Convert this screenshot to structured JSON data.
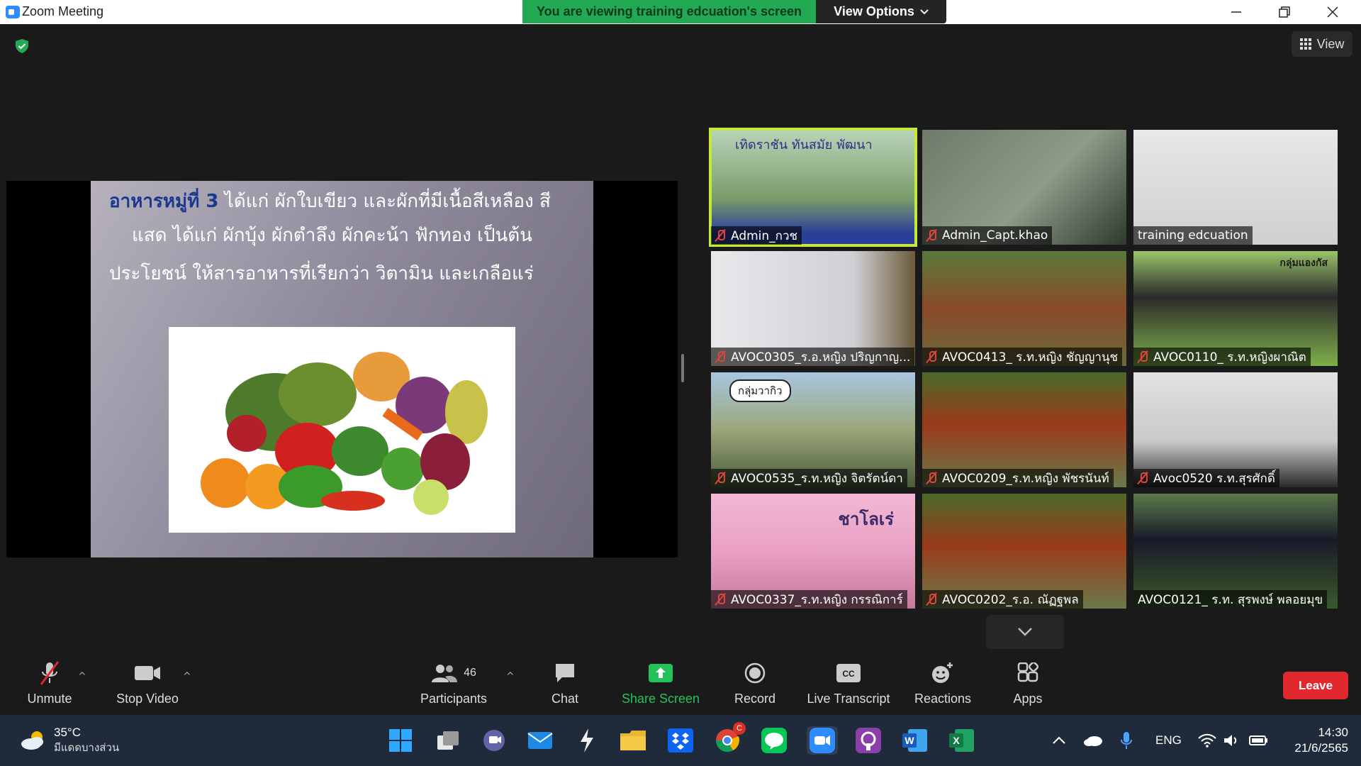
{
  "window": {
    "title": "Zoom Meeting",
    "viewing_banner": "You are viewing training edcuation's screen",
    "view_options": "View Options",
    "top_view_label": "View"
  },
  "slide": {
    "line1_highlight": "อาหารหมู่ที่ 3",
    "line1_rest": " ได้แก่ ผักใบเขียว และผักที่มีเนื้อสีเหลือง สี",
    "line2": "แสด ได้แก่ ผักบุ้ง ผักตำลึง ผักคะน้า ฟักทอง เป็นต้น",
    "line3": "ประโยชน์  ให้สารอาหารที่เรียกว่า วิตามิน และเกลือแร่"
  },
  "participants_tiles": [
    {
      "name": "Admin_กวช",
      "muted": true,
      "active": true,
      "banner_text": "เทิดราชัน   ทันสมัย   พัฒนา"
    },
    {
      "name": "Admin_Capt.khao",
      "muted": true,
      "active": false
    },
    {
      "name": "training edcuation",
      "muted": false,
      "active": false
    },
    {
      "name": "AVOC0305_ร.อ.หญิง ปริญกาญ...",
      "muted": true,
      "active": false
    },
    {
      "name": "AVOC0413_ ร.ท.หญิง ชัญญานุช",
      "muted": true,
      "active": false
    },
    {
      "name": "AVOC0110_ ร.ท.หญิงผาณิต",
      "muted": true,
      "active": false,
      "overlay_text": "กลุ่มแองกัส"
    },
    {
      "name": "AVOC0535_ร.ท.หญิง จิตรัตน์ดา",
      "muted": true,
      "active": false,
      "overlay_text": "กลุ่มวากิว"
    },
    {
      "name": "AVOC0209_ร.ท.หญิง พัชรนันท์",
      "muted": true,
      "active": false
    },
    {
      "name": "Avoc0520 ร.ท.สุรศักดิ์",
      "muted": true,
      "active": false
    },
    {
      "name": "AVOC0337_ร.ท.หญิง กรรณิการ์",
      "muted": true,
      "active": false,
      "overlay_text": "ชาโลเร่"
    },
    {
      "name": "AVOC0202_ร.อ. ณัฏฐพล",
      "muted": true,
      "active": false
    },
    {
      "name": "AVOC0121_ ร.ท. สุรพงษ์  พลอยมุข",
      "muted": false,
      "active": false
    }
  ],
  "toolbar": {
    "unmute": "Unmute",
    "stop_video": "Stop Video",
    "participants": "Participants",
    "participants_count": "46",
    "chat": "Chat",
    "share_screen": "Share Screen",
    "record": "Record",
    "live_transcript": "Live Transcript",
    "reactions": "Reactions",
    "apps": "Apps",
    "leave": "Leave"
  },
  "taskbar": {
    "weather_temp": "35°C",
    "weather_desc": "มีแดดบางส่วน",
    "language": "ENG",
    "time": "14:30",
    "date": "21/6/2565",
    "chrome_badge": "C"
  },
  "colors": {
    "banner_green": "#23a853",
    "leave_red": "#e0282e",
    "share_green": "#23c35a",
    "active_speaker": "#c5e83a"
  }
}
